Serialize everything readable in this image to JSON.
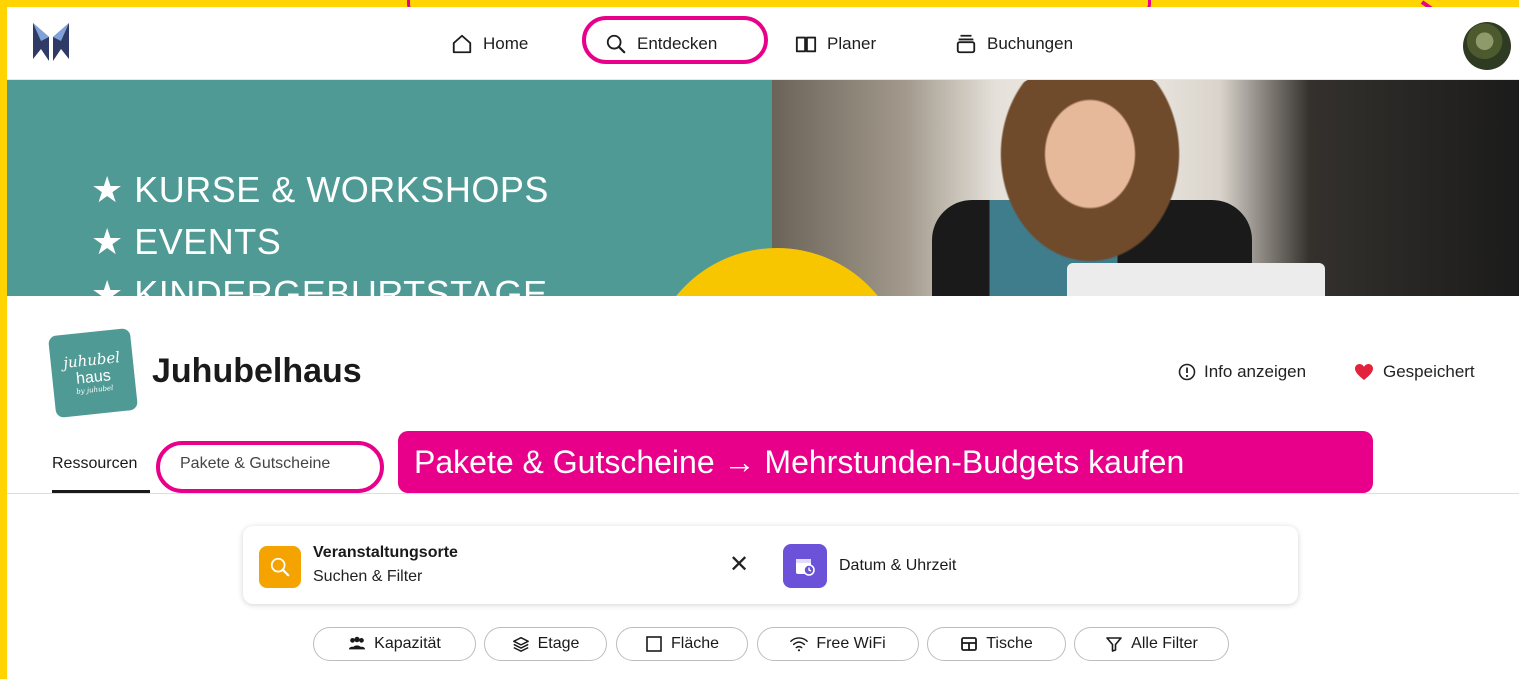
{
  "nav": {
    "items": [
      {
        "label": "Home",
        "icon": "home-icon"
      },
      {
        "label": "Entdecken",
        "icon": "search-icon"
      },
      {
        "label": "Planer",
        "icon": "book-icon"
      },
      {
        "label": "Buchungen",
        "icon": "stack-icon"
      }
    ],
    "avatar_icon": "user-avatar"
  },
  "hero": {
    "lines": [
      "★ KURSE & WORKSHOPS",
      "★ EVENTS",
      "★ KINDERGEBURTSTAGE"
    ]
  },
  "venue": {
    "logo_text_line1": "juhubel",
    "logo_text_line2": "haus",
    "logo_text_line3": "by juhubel",
    "name": "Juhubelhaus",
    "info_label": "Info anzeigen",
    "saved_label": "Gespeichert"
  },
  "tabs": [
    {
      "label": "Ressourcen",
      "active": true
    },
    {
      "label": "Pakete & Gutscheine",
      "active": false
    }
  ],
  "callout": {
    "text": "Pakete & Gutscheine → Mehrstunden-Budgets kaufen"
  },
  "search": {
    "title": "Veranstaltungsorte",
    "subtitle": "Suchen & Filter",
    "clear_symbol": "✕",
    "date_label": "Datum & Uhrzeit"
  },
  "filters": [
    {
      "label": "Kapazität",
      "icon": "people-icon"
    },
    {
      "label": "Etage",
      "icon": "layers-icon"
    },
    {
      "label": "Fläche",
      "icon": "square-icon"
    },
    {
      "label": "Free WiFi",
      "icon": "wifi-icon"
    },
    {
      "label": "Tische",
      "icon": "table-icon"
    },
    {
      "label": "Alle Filter",
      "icon": "filter-icon"
    }
  ],
  "colors": {
    "frame": "#FFD400",
    "highlight": "#E8008A",
    "teal": "#4F9A95",
    "search_orange": "#F5A300",
    "date_purple": "#6C52D9",
    "heart_red": "#E2233B"
  }
}
